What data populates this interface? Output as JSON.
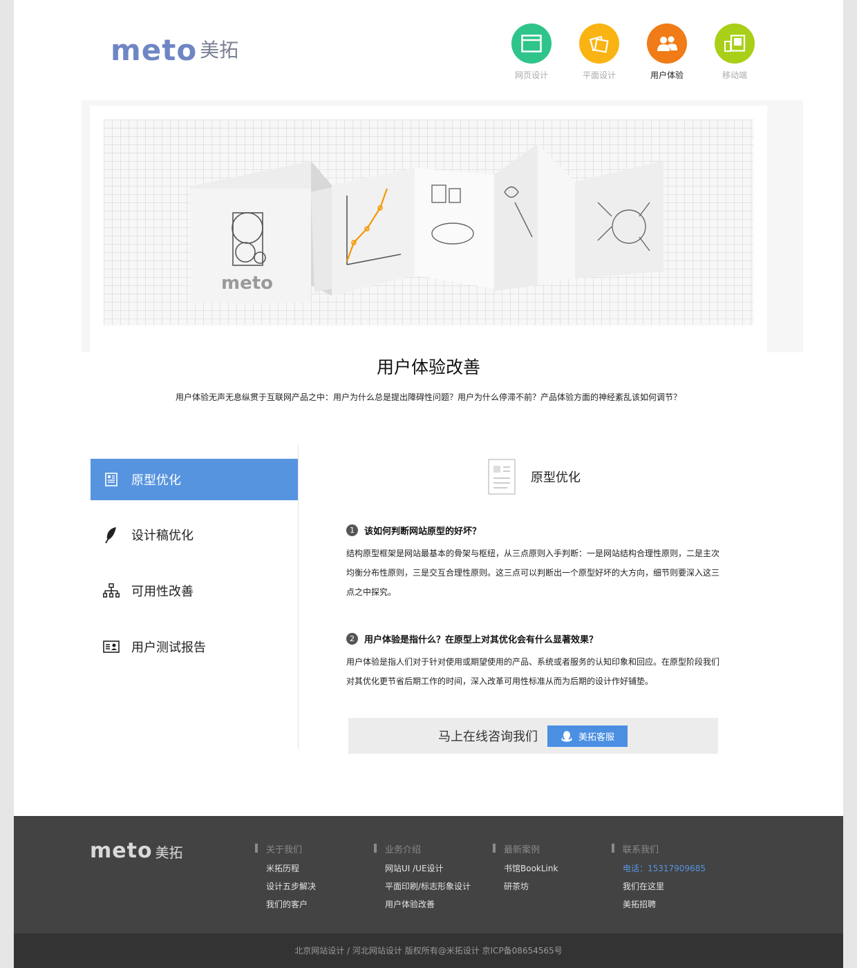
{
  "header": {
    "logo_mark": "meto",
    "logo_cn": "美拓",
    "nav": [
      {
        "label": "网页设计",
        "color": "#2fc48a",
        "icon": "browser-window-icon"
      },
      {
        "label": "平面设计",
        "color": "#f9b414",
        "icon": "stacked-cards-icon"
      },
      {
        "label": "用户体验",
        "color": "#f07b17",
        "icon": "users-icon",
        "active": true
      },
      {
        "label": "移动端",
        "color": "#a9cf18",
        "icon": "mobile-devices-icon"
      }
    ]
  },
  "banner": {
    "brand": "meto"
  },
  "section": {
    "title": "用户体验改善",
    "intro": "用户体验无声无息纵贯于互联网产品之中：用户为什么总是提出障碍性问题？用户为什么停滞不前？产品体验方面的神经紊乱该如何调节？"
  },
  "sidebar": {
    "items": [
      {
        "label": "原型优化",
        "icon": "document-icon",
        "active": true
      },
      {
        "label": "设计稿优化",
        "icon": "feather-icon"
      },
      {
        "label": "可用性改善",
        "icon": "hierarchy-icon"
      },
      {
        "label": "用户测试报告",
        "icon": "id-card-icon"
      }
    ]
  },
  "content": {
    "title": "原型优化",
    "q1_num": "1",
    "q1": "该如何判断网站原型的好坏？",
    "p1": "结构原型框架是网站最基本的骨架与枢纽，从三点原则入手判断：一是网站结构合理性原则，二是主次均衡分布性原则，三是交互合理性原则。这三点可以判断出一个原型好坏的大方向，细节则要深入这三点之中探究。",
    "q2_num": "2",
    "q2": "用户体验是指什么？在原型上对其优化会有什么显著效果？",
    "p2": "用户体验是指人们对于针对使用或期望使用的产品、系统或者服务的认知印象和回应。在原型阶段我们对其优化更节省后期工作的时间，深入改革可用性标准从而为后期的设计作好铺垫。",
    "cta_text": "马上在线咨询我们",
    "cta_button": "美拓客服"
  },
  "footer": {
    "logo_mark": "meto",
    "logo_cn": "美拓",
    "cols": [
      {
        "title": "关于我们",
        "links": [
          "米拓历程",
          "设计五步解决",
          "我们的客户"
        ]
      },
      {
        "title": "业务介绍",
        "links": [
          "网站UI /UE设计",
          "平面印刷/标志形象设计",
          "用户体验改善"
        ]
      },
      {
        "title": "最新案例",
        "links": [
          "书馆BookLink",
          "研茶坊"
        ]
      },
      {
        "title": "联系我们",
        "links": [
          "电话：15317909685",
          "我们在这里",
          "美拓招聘"
        ]
      }
    ],
    "copyright": "北京网站设计 / 河北网站设计 版权所有@米拓设计   京ICP备08654565号"
  }
}
